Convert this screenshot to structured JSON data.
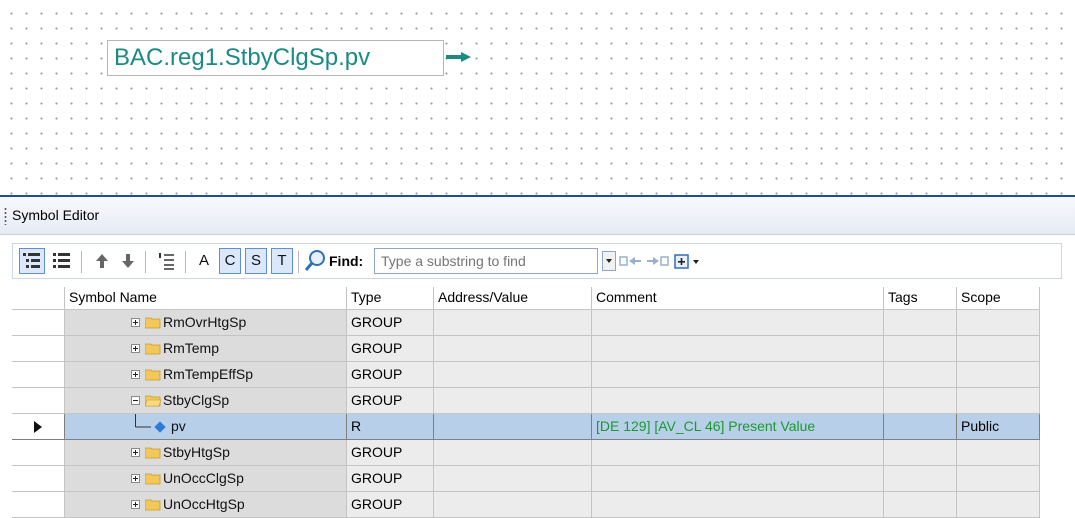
{
  "canvas": {
    "symbol_label": "BAC.reg1.StbyClgSp.pv",
    "label_color": "#1b8a82",
    "connector_color": "#1b8a82"
  },
  "panel": {
    "title": "Symbol Editor"
  },
  "toolbar": {
    "buttons": [
      {
        "name": "tree-view-icon",
        "active": true
      },
      {
        "name": "list-view-icon",
        "active": false
      },
      {
        "name": "move-up-icon",
        "active": false
      },
      {
        "name": "move-down-icon",
        "active": false
      },
      {
        "name": "sort-icon",
        "active": false
      }
    ],
    "filter_a": "A",
    "filter_c": "C",
    "filter_s": "S",
    "filter_t": "T",
    "find_label": "Find:",
    "find_placeholder": "Type a substring to find",
    "find_value": ""
  },
  "grid": {
    "columns": [
      "Symbol Name",
      "Type",
      "Address/Value",
      "Comment",
      "Tags",
      "Scope"
    ],
    "rows": [
      {
        "name": "RmOvrHtgSp",
        "type": "GROUP",
        "address": "",
        "comment": "",
        "tags": "",
        "scope": "",
        "expanded": false,
        "kind": "folder"
      },
      {
        "name": "RmTemp",
        "type": "GROUP",
        "address": "",
        "comment": "",
        "tags": "",
        "scope": "",
        "expanded": false,
        "kind": "folder"
      },
      {
        "name": "RmTempEffSp",
        "type": "GROUP",
        "address": "",
        "comment": "",
        "tags": "",
        "scope": "",
        "expanded": false,
        "kind": "folder"
      },
      {
        "name": "StbyClgSp",
        "type": "GROUP",
        "address": "",
        "comment": "",
        "tags": "",
        "scope": "",
        "expanded": true,
        "kind": "folder"
      },
      {
        "name": "pv",
        "type": "R",
        "address": "",
        "comment": "[DE 129]  [AV_CL 46] Present Value",
        "tags": "",
        "scope": "Public",
        "selected": true,
        "kind": "leaf"
      },
      {
        "name": "StbyHtgSp",
        "type": "GROUP",
        "address": "",
        "comment": "",
        "tags": "",
        "scope": "",
        "expanded": false,
        "kind": "folder"
      },
      {
        "name": "UnOccClgSp",
        "type": "GROUP",
        "address": "",
        "comment": "",
        "tags": "",
        "scope": "",
        "expanded": false,
        "kind": "folder"
      },
      {
        "name": "UnOccHtgSp",
        "type": "GROUP",
        "address": "",
        "comment": "",
        "tags": "",
        "scope": "",
        "expanded": false,
        "kind": "folder"
      }
    ],
    "selection_color": "#b8cfe9",
    "comment_color": "#1f8f2f"
  }
}
